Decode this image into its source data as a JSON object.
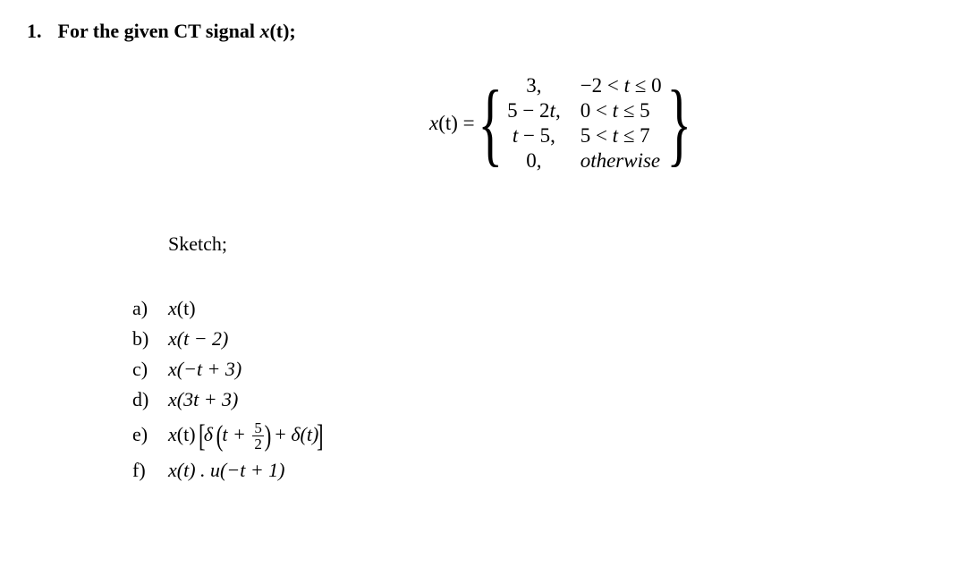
{
  "problem": {
    "number": "1.",
    "prompt_prefix": "For the given CT signal ",
    "prompt_var": "x",
    "prompt_arg": "(t)",
    "prompt_suffix": ";"
  },
  "piecewise": {
    "lhs_var": "x",
    "lhs_arg": "(t) = ",
    "rows": [
      {
        "expr": "3,",
        "cond_prefix": "−2 < ",
        "cond_var": "t",
        "cond_suffix": " ≤ 0"
      },
      {
        "expr_prefix": "5 − 2",
        "expr_var": "t",
        "expr_suffix": ",",
        "cond_prefix": "0 < ",
        "cond_var": "t",
        "cond_suffix": " ≤ 5"
      },
      {
        "expr_var": "t",
        "expr_suffix": " − 5,",
        "cond_prefix": "5 < ",
        "cond_var": "t",
        "cond_suffix": " ≤ 7"
      },
      {
        "expr": "0,",
        "cond_otherwise": "otherwise"
      }
    ]
  },
  "sketch_label": "Sketch;",
  "sub_items": {
    "a": {
      "letter": "a)",
      "var": "x",
      "args": "(t)"
    },
    "b": {
      "letter": "b)",
      "var": "x",
      "args": "(t − 2)"
    },
    "c": {
      "letter": "c)",
      "var": "x",
      "args": "(−t + 3)"
    },
    "d": {
      "letter": "d)",
      "var": "x",
      "args": "(3t + 3)"
    },
    "e": {
      "letter": "e)",
      "var": "x",
      "args": "(t) ",
      "delta1": "δ ",
      "inner_prefix": "t + ",
      "frac_num": "5",
      "frac_den": "2",
      "middle": " + ",
      "delta2": "δ",
      "delta2_args": "(t)"
    },
    "f": {
      "letter": "f)",
      "var1": "x",
      "args1": "(t) . ",
      "var2": "u",
      "args2": "(−t + 1)"
    }
  }
}
